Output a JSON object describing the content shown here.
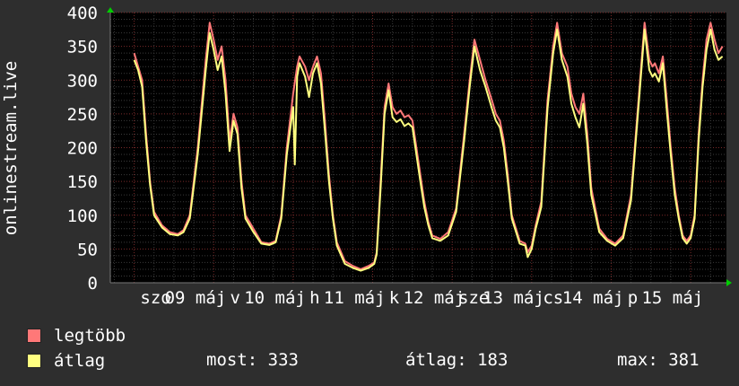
{
  "chart_data": {
    "type": "line",
    "ylabel": "onlinestream.live",
    "ylim": [
      0,
      400
    ],
    "yticks": [
      0,
      50,
      100,
      150,
      200,
      250,
      300,
      350,
      400
    ],
    "xticks": [
      "szo",
      "09 máj",
      "v",
      "10 máj",
      "h",
      "11 máj",
      "k",
      "12 máj",
      "sze",
      "13 máj",
      "cs",
      "14 máj",
      "p",
      "15 máj"
    ],
    "days": 7.15,
    "grid": true,
    "series": [
      {
        "name": "legtöbb",
        "color": "#ff7878",
        "points": [
          [
            0.0,
            340
          ],
          [
            0.05,
            320
          ],
          [
            0.1,
            300
          ],
          [
            0.15,
            220
          ],
          [
            0.2,
            150
          ],
          [
            0.25,
            105
          ],
          [
            0.35,
            85
          ],
          [
            0.45,
            75
          ],
          [
            0.55,
            72
          ],
          [
            0.62,
            78
          ],
          [
            0.7,
            100
          ],
          [
            0.8,
            200
          ],
          [
            0.9,
            330
          ],
          [
            0.95,
            385
          ],
          [
            1.0,
            360
          ],
          [
            1.05,
            330
          ],
          [
            1.1,
            350
          ],
          [
            1.15,
            300
          ],
          [
            1.2,
            210
          ],
          [
            1.25,
            250
          ],
          [
            1.3,
            230
          ],
          [
            1.35,
            150
          ],
          [
            1.4,
            100
          ],
          [
            1.5,
            80
          ],
          [
            1.6,
            60
          ],
          [
            1.7,
            58
          ],
          [
            1.78,
            62
          ],
          [
            1.85,
            100
          ],
          [
            1.92,
            200
          ],
          [
            2.0,
            280
          ],
          [
            2.05,
            320
          ],
          [
            2.08,
            335
          ],
          [
            2.15,
            320
          ],
          [
            2.2,
            300
          ],
          [
            2.25,
            320
          ],
          [
            2.3,
            335
          ],
          [
            2.35,
            310
          ],
          [
            2.4,
            240
          ],
          [
            2.45,
            160
          ],
          [
            2.5,
            100
          ],
          [
            2.55,
            60
          ],
          [
            2.65,
            32
          ],
          [
            2.75,
            25
          ],
          [
            2.85,
            20
          ],
          [
            2.95,
            25
          ],
          [
            3.02,
            30
          ],
          [
            3.05,
            45
          ],
          [
            3.1,
            150
          ],
          [
            3.15,
            260
          ],
          [
            3.2,
            295
          ],
          [
            3.25,
            260
          ],
          [
            3.3,
            250
          ],
          [
            3.35,
            255
          ],
          [
            3.4,
            245
          ],
          [
            3.45,
            248
          ],
          [
            3.5,
            240
          ],
          [
            3.55,
            200
          ],
          [
            3.6,
            160
          ],
          [
            3.65,
            120
          ],
          [
            3.7,
            90
          ],
          [
            3.75,
            70
          ],
          [
            3.85,
            65
          ],
          [
            3.95,
            75
          ],
          [
            4.05,
            110
          ],
          [
            4.15,
            220
          ],
          [
            4.22,
            300
          ],
          [
            4.28,
            360
          ],
          [
            4.35,
            330
          ],
          [
            4.42,
            300
          ],
          [
            4.5,
            270
          ],
          [
            4.55,
            250
          ],
          [
            4.6,
            240
          ],
          [
            4.65,
            210
          ],
          [
            4.7,
            160
          ],
          [
            4.75,
            100
          ],
          [
            4.85,
            62
          ],
          [
            4.92,
            58
          ],
          [
            4.95,
            45
          ],
          [
            5.0,
            55
          ],
          [
            5.05,
            85
          ],
          [
            5.12,
            120
          ],
          [
            5.2,
            270
          ],
          [
            5.27,
            350
          ],
          [
            5.32,
            385
          ],
          [
            5.38,
            340
          ],
          [
            5.45,
            320
          ],
          [
            5.5,
            280
          ],
          [
            5.55,
            260
          ],
          [
            5.6,
            250
          ],
          [
            5.65,
            280
          ],
          [
            5.7,
            220
          ],
          [
            5.75,
            140
          ],
          [
            5.85,
            80
          ],
          [
            5.95,
            65
          ],
          [
            6.05,
            58
          ],
          [
            6.15,
            70
          ],
          [
            6.25,
            130
          ],
          [
            6.35,
            280
          ],
          [
            6.42,
            385
          ],
          [
            6.48,
            330
          ],
          [
            6.52,
            320
          ],
          [
            6.55,
            325
          ],
          [
            6.6,
            310
          ],
          [
            6.65,
            335
          ],
          [
            6.7,
            270
          ],
          [
            6.75,
            200
          ],
          [
            6.8,
            140
          ],
          [
            6.85,
            100
          ],
          [
            6.9,
            70
          ],
          [
            6.95,
            62
          ],
          [
            7.0,
            70
          ],
          [
            7.05,
            100
          ],
          [
            7.1,
            220
          ],
          [
            7.15,
            300
          ],
          [
            7.2,
            360
          ],
          [
            7.25,
            385
          ],
          [
            7.3,
            360
          ],
          [
            7.35,
            340
          ],
          [
            7.4,
            350
          ]
        ]
      },
      {
        "name": "átlag",
        "color": "#ffff80",
        "points": [
          [
            0.0,
            330
          ],
          [
            0.05,
            315
          ],
          [
            0.1,
            290
          ],
          [
            0.15,
            210
          ],
          [
            0.2,
            145
          ],
          [
            0.25,
            100
          ],
          [
            0.35,
            82
          ],
          [
            0.45,
            72
          ],
          [
            0.55,
            70
          ],
          [
            0.62,
            75
          ],
          [
            0.7,
            95
          ],
          [
            0.8,
            190
          ],
          [
            0.9,
            315
          ],
          [
            0.95,
            370
          ],
          [
            1.0,
            345
          ],
          [
            1.05,
            315
          ],
          [
            1.1,
            335
          ],
          [
            1.15,
            280
          ],
          [
            1.2,
            195
          ],
          [
            1.25,
            240
          ],
          [
            1.3,
            220
          ],
          [
            1.35,
            140
          ],
          [
            1.4,
            95
          ],
          [
            1.5,
            75
          ],
          [
            1.6,
            58
          ],
          [
            1.7,
            56
          ],
          [
            1.78,
            60
          ],
          [
            1.85,
            95
          ],
          [
            1.92,
            190
          ],
          [
            2.0,
            260
          ],
          [
            2.02,
            175
          ],
          [
            2.05,
            305
          ],
          [
            2.08,
            325
          ],
          [
            2.15,
            305
          ],
          [
            2.2,
            275
          ],
          [
            2.25,
            310
          ],
          [
            2.3,
            325
          ],
          [
            2.35,
            295
          ],
          [
            2.4,
            225
          ],
          [
            2.45,
            150
          ],
          [
            2.5,
            95
          ],
          [
            2.55,
            55
          ],
          [
            2.65,
            28
          ],
          [
            2.75,
            22
          ],
          [
            2.85,
            18
          ],
          [
            2.95,
            22
          ],
          [
            3.02,
            28
          ],
          [
            3.05,
            42
          ],
          [
            3.1,
            140
          ],
          [
            3.15,
            250
          ],
          [
            3.2,
            285
          ],
          [
            3.25,
            245
          ],
          [
            3.3,
            238
          ],
          [
            3.35,
            242
          ],
          [
            3.4,
            232
          ],
          [
            3.45,
            236
          ],
          [
            3.5,
            230
          ],
          [
            3.55,
            190
          ],
          [
            3.6,
            150
          ],
          [
            3.65,
            112
          ],
          [
            3.7,
            85
          ],
          [
            3.75,
            66
          ],
          [
            3.85,
            62
          ],
          [
            3.95,
            70
          ],
          [
            4.05,
            105
          ],
          [
            4.15,
            210
          ],
          [
            4.22,
            290
          ],
          [
            4.28,
            350
          ],
          [
            4.35,
            315
          ],
          [
            4.42,
            290
          ],
          [
            4.5,
            258
          ],
          [
            4.55,
            240
          ],
          [
            4.6,
            230
          ],
          [
            4.65,
            200
          ],
          [
            4.7,
            150
          ],
          [
            4.75,
            95
          ],
          [
            4.85,
            58
          ],
          [
            4.92,
            55
          ],
          [
            4.95,
            38
          ],
          [
            5.0,
            50
          ],
          [
            5.05,
            80
          ],
          [
            5.12,
            112
          ],
          [
            5.2,
            258
          ],
          [
            5.27,
            340
          ],
          [
            5.32,
            375
          ],
          [
            5.38,
            330
          ],
          [
            5.45,
            305
          ],
          [
            5.5,
            265
          ],
          [
            5.55,
            245
          ],
          [
            5.6,
            230
          ],
          [
            5.65,
            265
          ],
          [
            5.7,
            205
          ],
          [
            5.75,
            130
          ],
          [
            5.85,
            75
          ],
          [
            5.95,
            62
          ],
          [
            6.05,
            55
          ],
          [
            6.15,
            66
          ],
          [
            6.25,
            122
          ],
          [
            6.35,
            270
          ],
          [
            6.42,
            375
          ],
          [
            6.48,
            315
          ],
          [
            6.52,
            305
          ],
          [
            6.55,
            310
          ],
          [
            6.6,
            298
          ],
          [
            6.65,
            325
          ],
          [
            6.7,
            255
          ],
          [
            6.75,
            190
          ],
          [
            6.8,
            130
          ],
          [
            6.85,
            95
          ],
          [
            6.9,
            66
          ],
          [
            6.95,
            58
          ],
          [
            7.0,
            66
          ],
          [
            7.05,
            95
          ],
          [
            7.1,
            210
          ],
          [
            7.15,
            290
          ],
          [
            7.2,
            345
          ],
          [
            7.25,
            375
          ],
          [
            7.3,
            345
          ],
          [
            7.35,
            330
          ],
          [
            7.4,
            335
          ]
        ]
      }
    ]
  },
  "legend": {
    "max_label": "legtöbb",
    "avg_label": "átlag",
    "stats": {
      "now": "most: 333",
      "avg": "átlag: 183",
      "max": "max: 381"
    }
  }
}
